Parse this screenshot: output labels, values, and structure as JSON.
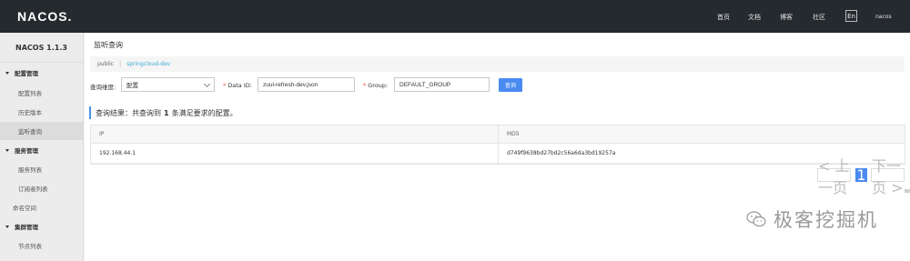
{
  "topbar": {
    "logo": "NACOS.",
    "nav": [
      {
        "label": "首页"
      },
      {
        "label": "文档"
      },
      {
        "label": "博客"
      },
      {
        "label": "社区"
      }
    ],
    "lang": "En",
    "user": "nacos"
  },
  "sidebar": {
    "version": "NACOS 1.1.3",
    "items": [
      {
        "label": "配置管理"
      },
      {
        "label": "配置列表"
      },
      {
        "label": "历史版本"
      },
      {
        "label": "监听查询"
      },
      {
        "label": "服务管理"
      },
      {
        "label": "服务列表"
      },
      {
        "label": "订阅者列表"
      },
      {
        "label": "命名空间"
      },
      {
        "label": "集群管理"
      },
      {
        "label": "节点列表"
      }
    ]
  },
  "main": {
    "title": "监听查询",
    "namespace": "public",
    "namespace_sep": "|",
    "namespace_id": "springcloud-dev",
    "filter": {
      "dimension_label": "查询维度:",
      "dimension_value": "配置",
      "dataid_label": "Data ID:",
      "dataid_value": "zuul-refresh-dev.json",
      "group_label": "Group:",
      "group_value": "DEFAULT_GROUP",
      "query_button": "查询"
    },
    "result": {
      "prefix": "查询结果：共查询到",
      "count": "1",
      "suffix": "条满足要求的配置。"
    },
    "table": {
      "columns": [
        "IP",
        "MD5"
      ],
      "rows": [
        {
          "ip": "192.168.44.1",
          "md5": "d749f9638bd27bd2c56a6da3bd19257a"
        }
      ]
    },
    "pager": {
      "prev": "< 上一页",
      "current": "1",
      "next": "下一页 >"
    }
  },
  "watermark": {
    "text": "极客挖掘机"
  }
}
